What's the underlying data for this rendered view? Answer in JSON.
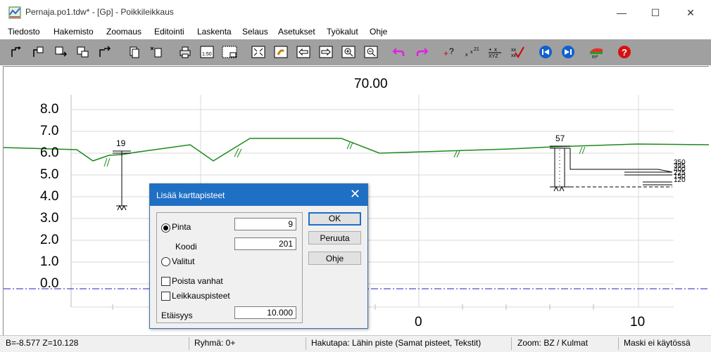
{
  "window": {
    "title": "Pernaja.po1.tdw* - [Gp] - Poikkileikkaus",
    "minimize": "—",
    "maximize": "☐",
    "close": "✕"
  },
  "menu": [
    "Tiedosto",
    "Hakemisto",
    "Zoomaus",
    "Editointi",
    "Laskenta",
    "Selaus",
    "Asetukset",
    "Työkalut",
    "Ohje"
  ],
  "drawing": {
    "section_label": "70.00",
    "y_ticks": [
      "8.0",
      "7.0",
      "6.0",
      "5.0",
      "4.0",
      "3.0",
      "2.0",
      "1.0",
      "0.0"
    ],
    "x_ticks": [
      "0",
      "10"
    ],
    "point_left": "19",
    "point_right": "57",
    "right_labels": [
      "350",
      "395",
      "400",
      "225",
      "150",
      "120"
    ],
    "ground_color": "#1a8a1a",
    "baseline_color": "#2020c0"
  },
  "dialog": {
    "title": "Lisää karttapisteet",
    "close": "✕",
    "radio_pinta": "Pinta",
    "pinta_value": "9",
    "koodi_label": "Koodi",
    "koodi_value": "201",
    "radio_valitut": "Valitut",
    "chk_poista": "Poista vanhat",
    "chk_leikkaus": "Leikkauspisteet",
    "etaisyys_label": "Etäisyys",
    "etaisyys_value": "10.000",
    "ok": "OK",
    "cancel": "Peruuta",
    "help": "Ohje"
  },
  "status": {
    "coords": "B=-8.577  Z=10.128",
    "group": "Ryhmä: 0+",
    "search": "Hakutapa: Lähin piste (Samat pisteet, Tekstit)",
    "zoom": "Zoom: BZ  /  Kulmat",
    "mask": "Maski ei käytössä"
  }
}
